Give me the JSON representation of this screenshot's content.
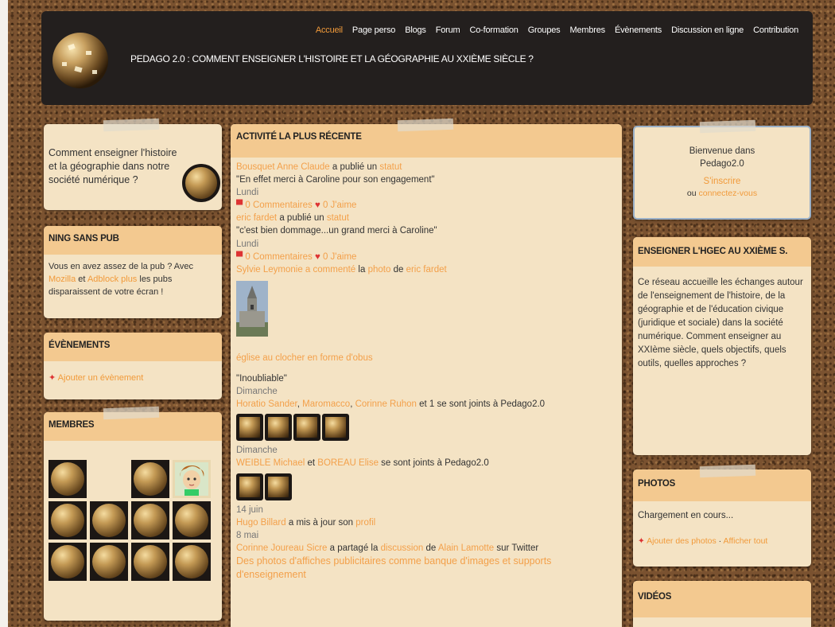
{
  "nav": {
    "items": [
      "Accueil",
      "Page perso",
      "Blogs",
      "Forum",
      "Co-formation",
      "Groupes",
      "Membres",
      "Évènements",
      "Discussion en ligne",
      "Contribution"
    ],
    "active": 0
  },
  "site_title": "PEDAGO 2.0 : COMMENT ENSEIGNER L'HISTOIRE ET LA GÉOGRAPHIE AU XXIÈME SIÈCLE ?",
  "left": {
    "intro": "Comment enseigner l'histoire et la géographie dans notre société numérique ?",
    "ning": {
      "title": "NING SANS PUB",
      "text_before": "Vous en avez assez de la pub ? Avec",
      "link1": "Mozilla",
      "text_mid": "et",
      "link2": "Adblock plus",
      "text_after": "les pubs disparaissent de votre écran !"
    },
    "events": {
      "title": "ÉVÈNEMENTS",
      "link": "Ajouter un évènement"
    },
    "members": {
      "title": "MEMBRES"
    }
  },
  "center": {
    "title": "ACTIVITÉ LA PLUS RÉCENTE",
    "a1": {
      "who": "Bousquet Anne Claude",
      "verb": "a publié un",
      "obj": "statut",
      "quote": "\"En effet merci à Caroline pour son engagement\"",
      "date": "Lundi",
      "comments": "0 Commentaires",
      "likes": "0 J'aime"
    },
    "a2": {
      "who": "eric fardet",
      "verb": "a publié un",
      "obj": "statut",
      "quote": "\"c'est bien dommage...un grand merci à Caroline\"",
      "date": "Lundi",
      "comments": "0 Commentaires",
      "likes": "0 J'aime"
    },
    "a3": {
      "who": "Sylvie Leymonie a commenté",
      "verb": "la",
      "obj": "photo",
      "de": "de",
      "author": "eric fardet",
      "caption": "église au clocher en forme d'obus",
      "quote": "\"Inoubliable\"",
      "date": "Dimanche"
    },
    "a4": {
      "n1": "Horatio Sander",
      "n2": "Maromacco",
      "n3": "Corinne Ruhon",
      "rest": "et 1 se sont joints à Pedago2.0",
      "date": "Dimanche"
    },
    "a5": {
      "n1": "WEIBLE Michael",
      "et": "et",
      "n2": "BOREAU Elise",
      "rest": "se sont joints à Pedago2.0",
      "date": "14 juin"
    },
    "a6": {
      "who": "Hugo Billard",
      "rest": "a mis à jour son",
      "obj": "profil",
      "date": "8 mai"
    },
    "a7": {
      "who": "Corinne Joureau Sicre",
      "rest": "a partagé la",
      "obj": "discussion",
      "de": "de",
      "author": "Alain Lamotte",
      "tail": "sur Twitter",
      "title": "Des photos d'affiches publicitaires comme banque d'images et supports d'enseignement"
    }
  },
  "right": {
    "welcome": {
      "line1": "Bienvenue dans",
      "line2": "Pedago2.0",
      "signup": "S'inscrire",
      "ou": "ou",
      "login": "connectez-vous"
    },
    "about": {
      "title": "ENSEIGNER L'HGEC AU XXIÈME S.",
      "text": "Ce réseau accueille les échanges autour de l'enseignement de l'histoire, de la géographie et de l'éducation civique (juridique et sociale) dans la société numérique. Comment enseigner au XXIème siècle, quels objectifs, quels outils, quelles approches ?"
    },
    "photos": {
      "title": "PHOTOS",
      "loading": "Chargement en cours...",
      "add": "Ajouter des photos",
      "sep": "·",
      "all": "Afficher tout"
    },
    "videos": {
      "title": "VIDÉOS"
    }
  }
}
